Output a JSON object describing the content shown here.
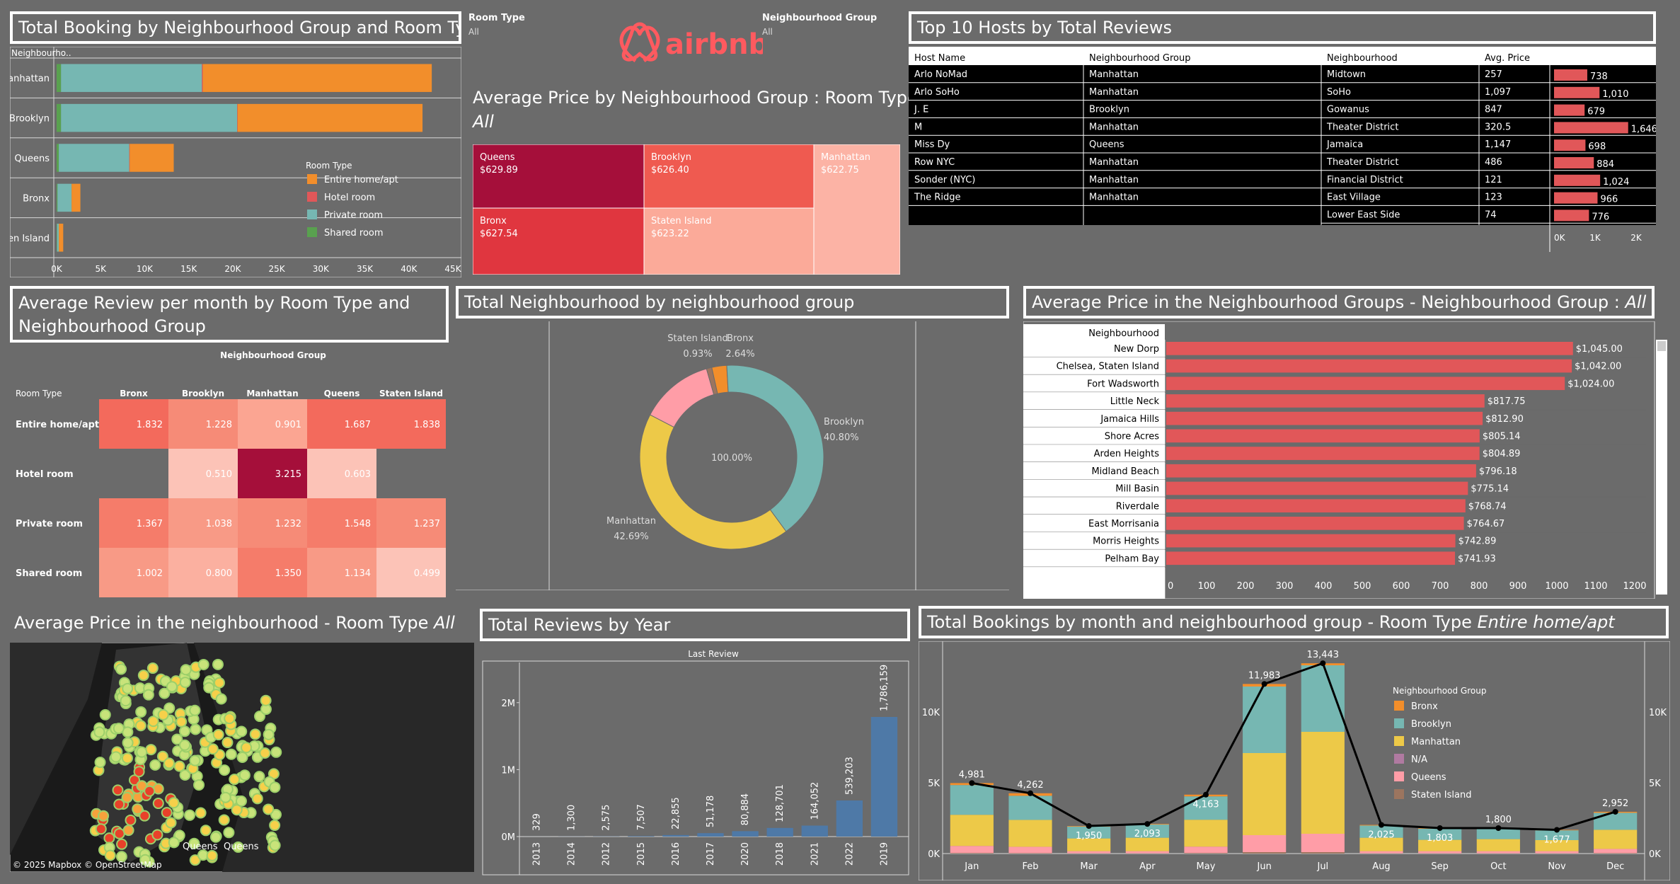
{
  "titles": {
    "booking": "Total Booking by Neighbourhood Group and Room Type",
    "price_treemap": "Average Price by Neighbourhood Group : Room Type",
    "price_treemap_sub": "All",
    "top_hosts": "Top 10 Hosts by Total Reviews",
    "review_month_line1": "Average Review per month by Room Type and",
    "review_month_line2": "Neighbourhood Group",
    "donut": "Total Neighbourhood by neighbourhood group",
    "price_groups": "Average Price in the Neighbourhood Groups - Neighbourhood Group : ",
    "price_groups_sub": "All",
    "map": "Average Price in the neighbourhood - Room Type ",
    "map_sub": "All",
    "reviews_year": "Total Reviews by Year",
    "bookings_month": "Total Bookings by month and neighbourhood group - Room Type ",
    "bookings_month_sub": "Entire home/apt"
  },
  "filters": {
    "room_type_label": "Room Type",
    "room_type_value": "All",
    "ng_label": "Neighbourhood Group",
    "ng_value": "All"
  },
  "logo": {
    "text": "airbnb"
  },
  "colors": {
    "entire": "#f28e2b",
    "hotel": "#e15759",
    "private": "#76b7b2",
    "shared": "#59a14f",
    "bronx": "#f28e2b",
    "brooklyn": "#76b7b2",
    "manhattan": "#edc948",
    "na": "#b07aa1",
    "queens": "#ff9da7",
    "staten": "#9c755f",
    "year_bar": "#4e79a7",
    "host_bar": "#e15759",
    "airbnb": "#ff5a5f"
  },
  "map": {
    "credit": "© 2025 Mapbox © OpenStreetMap",
    "labels": [
      "Queens",
      "Queens"
    ]
  },
  "chart_data": [
    {
      "id": "booking",
      "type": "bar",
      "orientation": "horizontal",
      "stacked": true,
      "row_header": "Neighbourho..",
      "categories": [
        "Manhattan",
        "Brooklyn",
        "Queens",
        "Bronx",
        "Staten Island"
      ],
      "series": [
        {
          "name": "Shared room",
          "color": "#59a14f",
          "values": [
            500,
            500,
            250,
            100,
            50
          ]
        },
        {
          "name": "Private room",
          "color": "#76b7b2",
          "values": [
            16000,
            20000,
            8000,
            1600,
            200
          ]
        },
        {
          "name": "Hotel room",
          "color": "#e15759",
          "values": [
            100,
            50,
            50,
            0,
            0
          ]
        },
        {
          "name": "Entire home/apt",
          "color": "#f28e2b",
          "values": [
            26000,
            21000,
            5000,
            1000,
            500
          ]
        }
      ],
      "xticks": [
        "0K",
        "5K",
        "10K",
        "15K",
        "20K",
        "25K",
        "30K",
        "35K",
        "40K",
        "45K"
      ],
      "xlim": [
        0,
        45000
      ],
      "legend": {
        "title": "Room Type",
        "items": [
          {
            "name": "Entire home/apt",
            "color": "#f28e2b"
          },
          {
            "name": "Hotel room",
            "color": "#e15759"
          },
          {
            "name": "Private room",
            "color": "#76b7b2"
          },
          {
            "name": "Shared room",
            "color": "#59a14f"
          }
        ]
      }
    },
    {
      "id": "price_treemap",
      "type": "treemap",
      "cells": [
        {
          "name": "Queens",
          "value": "$629.89",
          "color": "#a50f3a"
        },
        {
          "name": "Brooklyn",
          "value": "$626.40",
          "color": "#ef5a50"
        },
        {
          "name": "Manhattan",
          "value": "$622.75",
          "color": "#fcb3a5"
        },
        {
          "name": "Bronx",
          "value": "$627.54",
          "color": "#e0363f"
        },
        {
          "name": "Staten Island",
          "value": "$623.22",
          "color": "#fbaa99"
        }
      ]
    },
    {
      "id": "top_hosts",
      "type": "table",
      "columns": [
        "Host Name",
        "Neighbourhood Group",
        "Neighbourhood",
        "Avg. Price"
      ],
      "rows": [
        {
          "host": "Arlo NoMad",
          "group": "Manhattan",
          "hood": "Midtown",
          "price": "257",
          "reviews": 738,
          "label": "738"
        },
        {
          "host": "Arlo SoHo",
          "group": "Manhattan",
          "hood": "SoHo",
          "price": "1,097",
          "reviews": 1010,
          "label": "1,010"
        },
        {
          "host": "J. E",
          "group": "Brooklyn",
          "hood": "Gowanus",
          "price": "847",
          "reviews": 679,
          "label": "679"
        },
        {
          "host": "M",
          "group": "Manhattan",
          "hood": "Theater District",
          "price": "320.5",
          "reviews": 1646,
          "label": "1,646"
        },
        {
          "host": "Miss Dy",
          "group": "Queens",
          "hood": "Jamaica",
          "price": "1,147",
          "reviews": 698,
          "label": "698"
        },
        {
          "host": "Row NYC",
          "group": "Manhattan",
          "hood": "Theater District",
          "price": "486",
          "reviews": 884,
          "label": "884"
        },
        {
          "host": "Sonder (NYC)",
          "group": "Manhattan",
          "hood": "Financial District",
          "price": "121",
          "reviews": 1024,
          "label": "1,024"
        },
        {
          "host": "The Ridge",
          "group": "Manhattan",
          "hood": "East Village",
          "price": "123",
          "reviews": 966,
          "label": "966"
        },
        {
          "host": "",
          "group": "",
          "hood": "Lower East Side",
          "price": "74",
          "reviews": 776,
          "label": "776"
        }
      ],
      "xticks": [
        "0K",
        "1K",
        "2K"
      ],
      "xlim": [
        0,
        2200
      ]
    },
    {
      "id": "review_month",
      "type": "heatmap",
      "col_title": "Neighbourhood Group",
      "row_header": "Room Type",
      "columns": [
        "Bronx",
        "Brooklyn",
        "Manhattan",
        "Queens",
        "Staten Island"
      ],
      "rows": [
        "Entire home/apt",
        "Hotel room",
        "Private room",
        "Shared room"
      ],
      "values": [
        [
          1.832,
          1.228,
          0.901,
          1.687,
          1.838
        ],
        [
          null,
          0.51,
          3.215,
          0.603,
          null
        ],
        [
          1.367,
          1.038,
          1.232,
          1.548,
          1.237
        ],
        [
          1.002,
          0.8,
          1.35,
          1.134,
          0.499
        ]
      ],
      "labels": [
        [
          "1.832",
          "1.228",
          "0.901",
          "1.687",
          "1.838"
        ],
        [
          "",
          "0.510",
          "3.215",
          "0.603",
          ""
        ],
        [
          "1.367",
          "1.038",
          "1.232",
          "1.548",
          "1.237"
        ],
        [
          "1.002",
          "0.800",
          "1.350",
          "1.134",
          "0.499"
        ]
      ]
    },
    {
      "id": "donut",
      "type": "pie",
      "center_label": "100.00%",
      "slices": [
        {
          "name": "Bronx",
          "pct": 2.64,
          "label": "2.64%",
          "color": "#f28e2b"
        },
        {
          "name": "Brooklyn",
          "pct": 40.8,
          "label": "40.80%",
          "color": "#76b7b2"
        },
        {
          "name": "Manhattan",
          "pct": 42.69,
          "label": "42.69%",
          "color": "#edc948"
        },
        {
          "name": "Queens",
          "pct": 12.94,
          "label": "",
          "color": "#ff9da7"
        },
        {
          "name": "Staten Island",
          "pct": 0.93,
          "label": "0.93%",
          "color": "#9c755f"
        }
      ]
    },
    {
      "id": "price_groups",
      "type": "bar",
      "orientation": "horizontal",
      "row_header": "Neighbourhood",
      "categories": [
        "New Dorp",
        "Chelsea, Staten Island",
        "Fort Wadsworth",
        "Little Neck",
        "Jamaica Hills",
        "Shore Acres",
        "Arden Heights",
        "Midland Beach",
        "Mill Basin",
        "Riverdale",
        "East Morrisania",
        "Morris Heights",
        "Pelham Bay"
      ],
      "values": [
        1045.0,
        1042.0,
        1024.0,
        817.75,
        812.9,
        805.14,
        804.89,
        796.18,
        775.14,
        768.74,
        764.67,
        742.89,
        741.93
      ],
      "labels": [
        "$1,045.00",
        "$1,042.00",
        "$1,024.00",
        "$817.75",
        "$812.90",
        "$805.14",
        "$804.89",
        "$796.18",
        "$775.14",
        "$768.74",
        "$764.67",
        "$742.89",
        "$741.93"
      ],
      "xticks": [
        "0",
        "100",
        "200",
        "300",
        "400",
        "500",
        "600",
        "700",
        "800",
        "900",
        "1000",
        "1100",
        "1200"
      ],
      "xlim": [
        0,
        1200
      ]
    },
    {
      "id": "reviews_year",
      "type": "bar",
      "title": "Last Review",
      "categories": [
        "2013",
        "2014",
        "2012",
        "2015",
        "2016",
        "2017",
        "2020",
        "2018",
        "2021",
        "2022",
        "2019"
      ],
      "values": [
        329,
        1300,
        2575,
        7507,
        22855,
        51178,
        80884,
        128701,
        164052,
        539203,
        1786159
      ],
      "labels": [
        "329",
        "1,300",
        "2,575",
        "7,507",
        "22,855",
        "51,178",
        "80,884",
        "128,701",
        "164,052",
        "539,203",
        "1,786,159"
      ],
      "yticks": [
        "0M",
        "1M",
        "2M"
      ],
      "ylim": [
        0,
        2600000
      ]
    },
    {
      "id": "bookings_month",
      "type": "bar",
      "stacked": true,
      "categories": [
        "Jan",
        "Feb",
        "Mar",
        "Apr",
        "May",
        "Jun",
        "Jul",
        "Aug",
        "Sep",
        "Oct",
        "Nov",
        "Dec"
      ],
      "series": [
        {
          "name": "Staten Island",
          "color": "#9c755f",
          "values": [
            40,
            30,
            20,
            20,
            40,
            100,
            100,
            20,
            20,
            20,
            20,
            30
          ]
        },
        {
          "name": "Queens",
          "color": "#ff9da7",
          "values": [
            500,
            450,
            150,
            150,
            450,
            1200,
            1300,
            150,
            150,
            150,
            150,
            300
          ]
        },
        {
          "name": "N/A",
          "color": "#b07aa1",
          "values": [
            0,
            0,
            0,
            0,
            0,
            0,
            0,
            0,
            0,
            0,
            0,
            0
          ]
        },
        {
          "name": "Manhattan",
          "color": "#edc948",
          "values": [
            2200,
            1900,
            900,
            950,
            1900,
            5800,
            7200,
            950,
            800,
            850,
            780,
            1350
          ]
        },
        {
          "name": "Brooklyn",
          "color": "#76b7b2",
          "values": [
            2100,
            1700,
            840,
            930,
            1650,
            4700,
            4700,
            860,
            790,
            740,
            690,
            1200
          ]
        },
        {
          "name": "Bronx",
          "color": "#f28e2b",
          "values": [
            141,
            182,
            40,
            43,
            123,
            183,
            143,
            45,
            43,
            40,
            37,
            72
          ]
        }
      ],
      "totals": [
        4981,
        4262,
        1950,
        2093,
        4163,
        11983,
        13443,
        2025,
        1803,
        1800,
        1677,
        2952
      ],
      "total_labels": [
        "4,981",
        "4,262",
        "1,950",
        "2,093",
        "4,163",
        "11,983",
        "13,443",
        "2,025",
        "1,803",
        "1,800",
        "1,677",
        "2,952"
      ],
      "yticks": [
        "0K",
        "5K",
        "10K"
      ],
      "ylim": [
        0,
        14500
      ],
      "legend": {
        "title": "Neighbourhood Group",
        "items": [
          {
            "name": "Bronx",
            "color": "#f28e2b"
          },
          {
            "name": "Brooklyn",
            "color": "#76b7b2"
          },
          {
            "name": "Manhattan",
            "color": "#edc948"
          },
          {
            "name": "N/A",
            "color": "#b07aa1"
          },
          {
            "name": "Queens",
            "color": "#ff9da7"
          },
          {
            "name": "Staten Island",
            "color": "#9c755f"
          }
        ]
      }
    }
  ]
}
